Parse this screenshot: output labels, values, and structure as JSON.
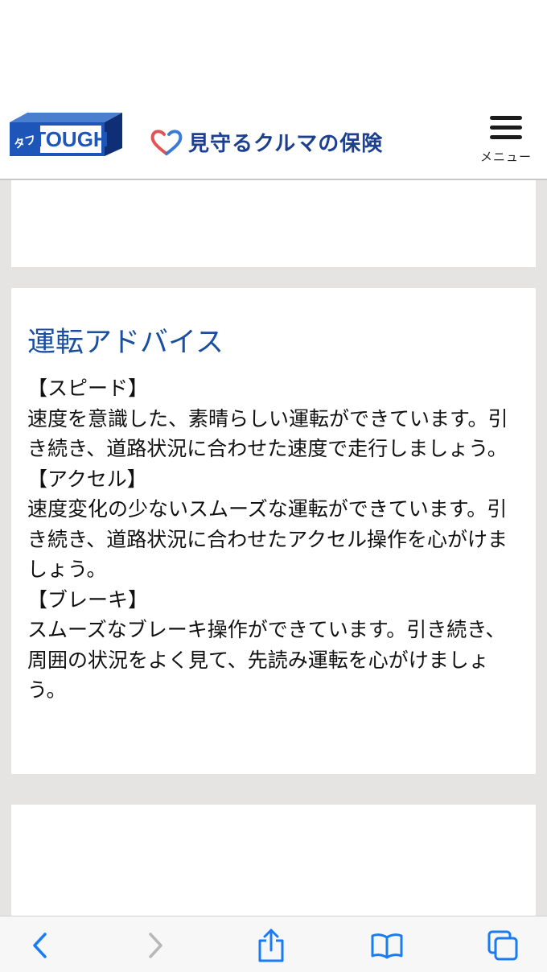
{
  "header": {
    "logo_text": "TOUGH",
    "logo_kana": "タフ",
    "brand_title": "見守るクルマの保険",
    "menu_label": "メニュー"
  },
  "advice_card": {
    "title": "運転アドバイス",
    "sections": [
      {
        "heading": "【スピード】",
        "text": "速度を意識した、素晴らしい運転ができています。引き続き、道路状況に合わせた速度で走行しましょう。"
      },
      {
        "heading": "【アクセル】",
        "text": "速度変化の少ないスムーズな運転ができています。引き続き、道路状況に合わせたアクセル操作を心がけましょう。"
      },
      {
        "heading": "【ブレーキ】",
        "text": "スムーズなブレーキ操作ができています。引き続き、周囲の状況をよく見て、先読み運転を心がけましょう。"
      }
    ]
  },
  "toolbar": {
    "icons": [
      "back-icon",
      "forward-icon",
      "share-icon",
      "bookmarks-icon",
      "tabs-icon"
    ]
  },
  "colors": {
    "accent": "#1a4fa0",
    "brand": "#1c3f8f",
    "page_background": "#e6e3e3",
    "toolbar_icon": "#1a7cf5",
    "toolbar_icon_disabled": "#b8b8b8"
  }
}
